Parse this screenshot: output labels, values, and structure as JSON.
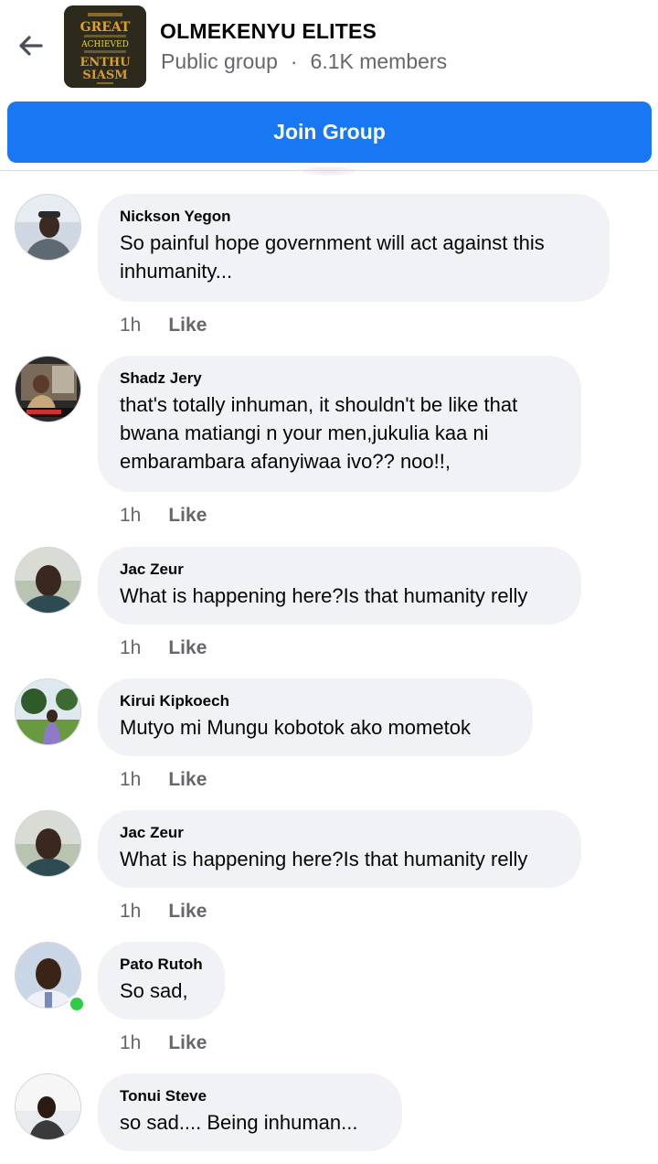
{
  "header": {
    "title": "OLMEKENYU ELITES",
    "privacy": "Public group",
    "separator": "·",
    "members": "6.1K members",
    "thumb_lines": [
      "GREAT",
      "ACHIEVED",
      "ENTHU",
      "SIASM"
    ]
  },
  "join_label": "Join Group",
  "colors": {
    "primary": "#1877f2",
    "bubble": "#f0f2f5",
    "meta": "#65676b",
    "online": "#31cc46"
  },
  "comments": [
    {
      "author": "Nickson Yegon",
      "text": "So painful hope government will act against this inhumanity...",
      "time": "1h",
      "like": "Like"
    },
    {
      "author": "Shadz Jery",
      "text": "that's totally inhuman, it shouldn't be like that bwana matiangi n your men,jukulia kaa ni embarambara afanyiwaa ivo?? noo!!,",
      "time": "1h",
      "like": "Like"
    },
    {
      "author": "Jac Zeur",
      "text": "What is happening here?Is that humanity relly",
      "time": "1h",
      "like": "Like"
    },
    {
      "author": "Kirui Kipkoech",
      "text": "Mutyo mi Mungu kobotok ako mometok",
      "time": "1h",
      "like": "Like"
    },
    {
      "author": "Jac Zeur",
      "text": "What is happening here?Is that humanity relly",
      "time": "1h",
      "like": "Like"
    },
    {
      "author": "Pato Rutoh",
      "text": "So sad,",
      "time": "1h",
      "like": "Like",
      "online": true
    },
    {
      "author": "Tonui Steve",
      "text": "so sad.... Being inhuman...",
      "time": "",
      "like": ""
    }
  ]
}
